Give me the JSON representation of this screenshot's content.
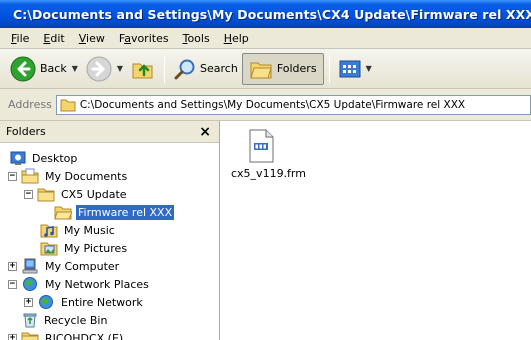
{
  "window": {
    "title": "C:\\Documents and Settings\\My Documents\\CX4 Update\\Firmware rel XXX"
  },
  "menu": [
    {
      "label": "File",
      "u": "F",
      "rest": "ile"
    },
    {
      "label": "Edit",
      "u": "E",
      "rest": "dit"
    },
    {
      "label": "View",
      "u": "V",
      "rest": "iew"
    },
    {
      "label": "Favorites",
      "pre": "F",
      "u": "a",
      "rest": "vorites"
    },
    {
      "label": "Tools",
      "u": "T",
      "rest": "ools"
    },
    {
      "label": "Help",
      "u": "H",
      "rest": "elp"
    }
  ],
  "toolbar": {
    "back_label": "Back",
    "search_label": "Search",
    "folders_label": "Folders"
  },
  "address": {
    "label": "Address",
    "value": "C:\\Documents and Settings\\My Documents\\CX5 Update\\Firmware rel XXX"
  },
  "folders_pane": {
    "title": "Folders",
    "close_glyph": "×",
    "tree": [
      {
        "label": "Desktop"
      },
      {
        "label": "My Documents",
        "expander": "−"
      },
      {
        "label": "CX5 Update",
        "expander": "−"
      },
      {
        "label": "Firmware rel XXX",
        "selected": true
      },
      {
        "label": "My Music"
      },
      {
        "label": "My Pictures"
      },
      {
        "label": "My Computer",
        "expander": "+"
      },
      {
        "label": "My Network Places",
        "expander": "−"
      },
      {
        "label": "Entire Network",
        "expander": "+"
      },
      {
        "label": "Recycle Bin"
      },
      {
        "label": "RICOHDCX (E)",
        "expander": "+"
      }
    ]
  },
  "files": [
    {
      "name": "cx5_v119.frm"
    }
  ],
  "colors": {
    "titlebar": "#0054e3",
    "selection": "#316ac5",
    "chrome": "#ece9d8"
  }
}
